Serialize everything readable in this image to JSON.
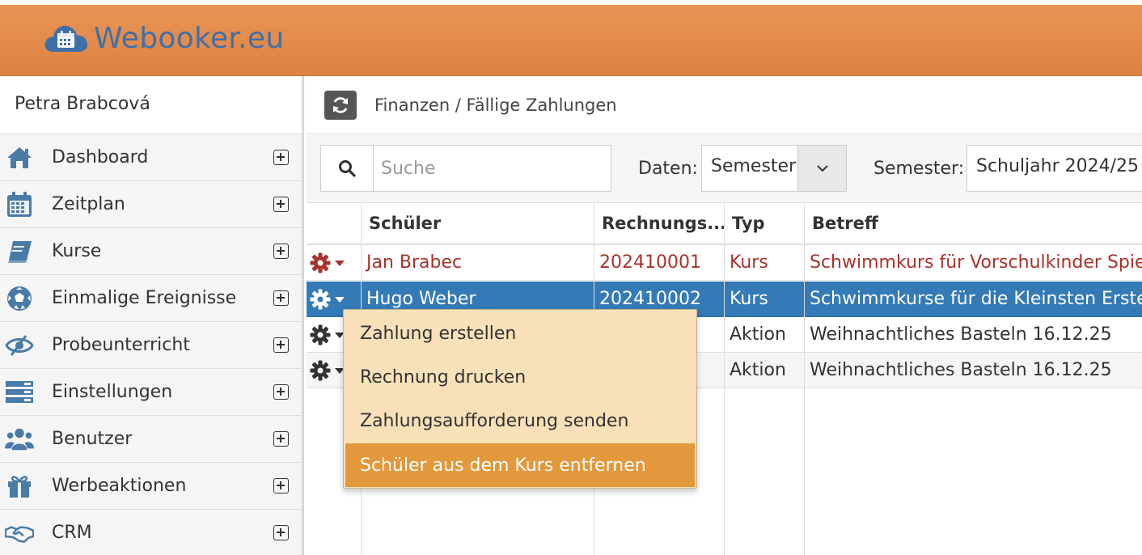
{
  "brand": {
    "name": "Webooker.eu",
    "header_color": "#e08a47",
    "logo_color": "#3f6fa9"
  },
  "sidebar": {
    "user_name": "Petra Brabcová",
    "items": [
      {
        "label": "Dashboard",
        "icon": "home-icon"
      },
      {
        "label": "Zeitplan",
        "icon": "calendar-icon"
      },
      {
        "label": "Kurse",
        "icon": "book-icon"
      },
      {
        "label": "Einmalige Ereignisse",
        "icon": "soccer-ball-icon"
      },
      {
        "label": "Probeunterricht",
        "icon": "eye-icon"
      },
      {
        "label": "Einstellungen",
        "icon": "server-icon"
      },
      {
        "label": "Benutzer",
        "icon": "users-icon"
      },
      {
        "label": "Werbeaktionen",
        "icon": "gift-icon"
      },
      {
        "label": "CRM",
        "icon": "handshake-icon"
      }
    ]
  },
  "main": {
    "breadcrumb": "Finanzen / Fällige Zahlungen",
    "search": {
      "placeholder": "Suche",
      "value": ""
    },
    "filters": {
      "daten_label": "Daten:",
      "daten_value": "Semester",
      "semester_label": "Semester:",
      "semester_value": "Schuljahr 2024/25"
    },
    "table": {
      "columns": [
        "Schüler",
        "Rechnungs...",
        "Typ",
        "Betreff"
      ],
      "rows": [
        {
          "student": "Jan Brabec",
          "invoice": "202410001",
          "type": "Kurs",
          "subject": "Schwimmkurs für Vorschulkinder Spiel",
          "state": "overdue"
        },
        {
          "student": "Hugo Weber",
          "invoice": "202410002",
          "type": "Kurs",
          "subject": "Schwimmkurse für die Kleinsten Ersten",
          "state": "selected"
        },
        {
          "student": "",
          "invoice": "",
          "type": "Aktion",
          "subject": "Weihnachtliches Basteln 16.12.25",
          "state": "normal"
        },
        {
          "student": "",
          "invoice": "",
          "type": "Aktion",
          "subject": "Weihnachtliches Basteln 16.12.25",
          "state": "normal"
        }
      ]
    },
    "row_menu": {
      "items": [
        "Zahlung erstellen",
        "Rechnung drucken",
        "Zahlungsaufforderung senden",
        "Schüler aus dem Kurs entfernen"
      ],
      "active_index": 3
    }
  },
  "colors": {
    "selected_row": "#337ab7",
    "overdue_text": "#a8322c",
    "menu_bg": "#f8e1b8",
    "menu_active": "#e3983b"
  }
}
